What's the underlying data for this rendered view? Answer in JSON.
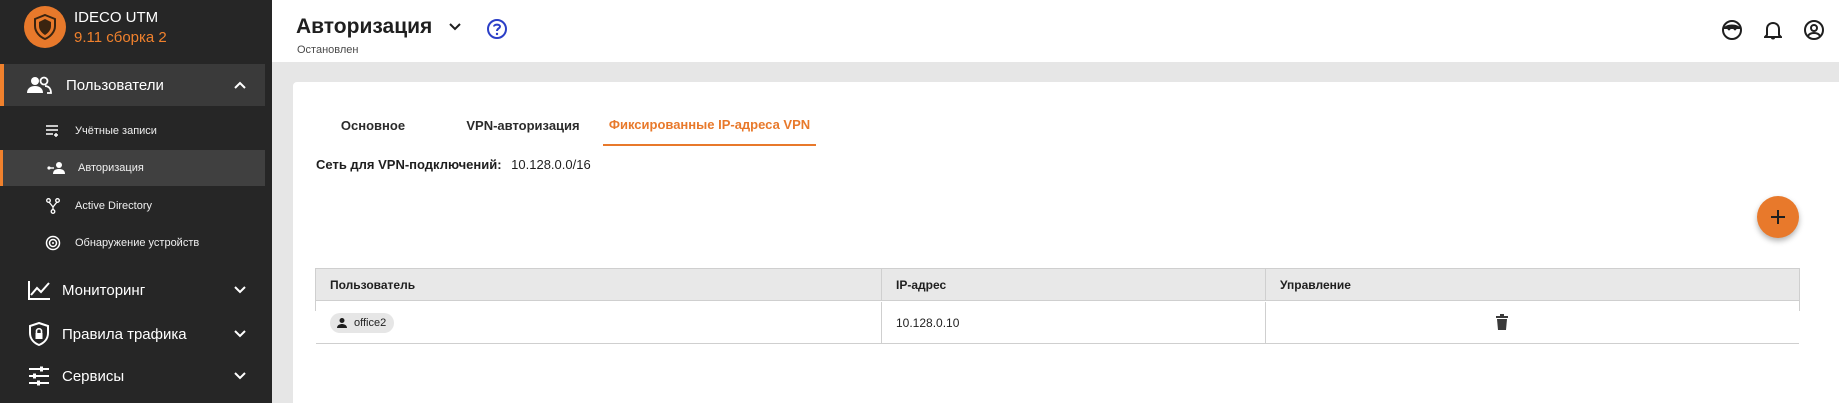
{
  "brand": {
    "name": "IDECO UTM",
    "version": "9.11 сборка 2",
    "accent": "#e8792b"
  },
  "sidebar": {
    "groups": [
      {
        "label": "Пользователи",
        "icon": "users-icon",
        "expanded": true
      },
      {
        "label": "Мониторинг",
        "icon": "chart-line-icon",
        "expanded": false
      },
      {
        "label": "Правила трафика",
        "icon": "shield-lock-icon",
        "expanded": false
      },
      {
        "label": "Сервисы",
        "icon": "sliders-icon",
        "expanded": false
      }
    ],
    "sub_items": [
      {
        "label": "Учётные записи",
        "icon": "list-icon"
      },
      {
        "label": "Авторизация",
        "icon": "user-auth-icon",
        "active": true
      },
      {
        "label": "Active Directory",
        "icon": "tree-icon"
      },
      {
        "label": "Обнаружение устройств",
        "icon": "radar-icon"
      }
    ]
  },
  "header": {
    "title": "Авторизация",
    "status": "Остановлен",
    "icons": [
      "support-icon",
      "bell-icon",
      "account-icon"
    ]
  },
  "tabs": [
    {
      "label": "Основное"
    },
    {
      "label": "VPN-авторизация"
    },
    {
      "label": "Фиксированные IP-адреса VPN",
      "active": true
    }
  ],
  "network": {
    "label": "Сеть для VPN-подключений:",
    "value": "10.128.0.0/16"
  },
  "table": {
    "columns": [
      "Пользователь",
      "IP-адрес",
      "Управление"
    ],
    "rows": [
      {
        "user": "office2",
        "ip": "10.128.0.10"
      }
    ]
  }
}
